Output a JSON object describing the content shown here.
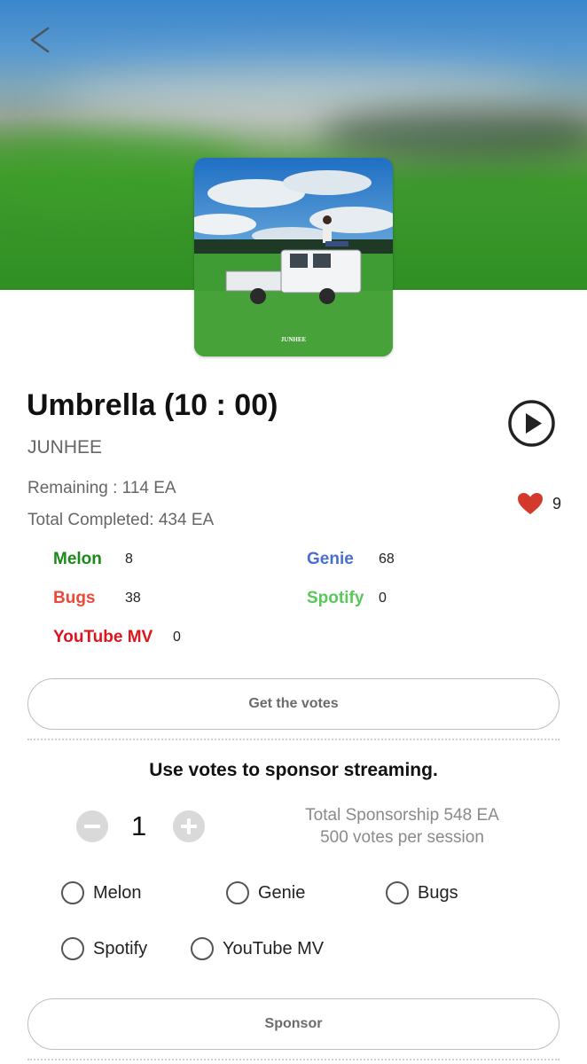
{
  "header": {
    "back_icon": "chevron-left-icon"
  },
  "album": {
    "cover_text": "JUNHEE"
  },
  "song": {
    "title": "Umbrella (10 : 00)",
    "artist": "JUNHEE"
  },
  "stats": {
    "remaining": "Remaining : 114 EA",
    "completed": "Total Completed: 434 EA"
  },
  "likes": {
    "count": "9",
    "color": "#d33a2c"
  },
  "platforms": [
    {
      "name": "Melon",
      "count": "8",
      "color": "#1a8a1a"
    },
    {
      "name": "Genie",
      "count": "68",
      "color": "#4a6fd0"
    },
    {
      "name": "Bugs",
      "count": "38",
      "color": "#ec4a3a"
    },
    {
      "name": "Spotify",
      "count": "0",
      "color": "#59c85a"
    },
    {
      "name": "YouTube MV",
      "count": "0",
      "color": "#e0141e"
    }
  ],
  "buttons": {
    "get_votes": "Get the votes",
    "sponsor": "Sponsor"
  },
  "sponsor": {
    "heading": "Use votes to sponsor streaming.",
    "quantity": "1",
    "total": "Total Sponsorship 548 EA",
    "per_session": "500 votes per session"
  },
  "options": [
    "Melon",
    "Genie",
    "Bugs",
    "Spotify",
    "YouTube MV"
  ]
}
